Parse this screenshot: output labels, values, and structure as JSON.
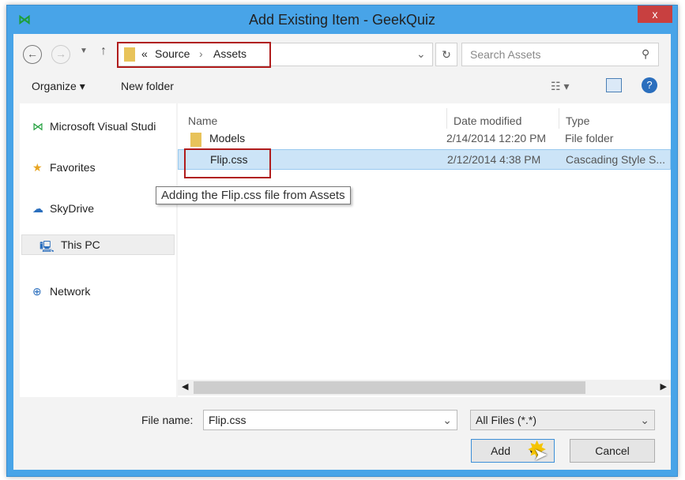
{
  "window": {
    "title": "Add Existing Item - GeekQuiz",
    "close": "x"
  },
  "address": {
    "prefix": "«",
    "path": [
      "Source",
      "Assets"
    ],
    "sep": "›"
  },
  "search": {
    "placeholder": "Search Assets"
  },
  "toolbar": {
    "organize": "Organize ▾",
    "new_folder": "New folder"
  },
  "sidebar": {
    "items": [
      {
        "label": "Microsoft Visual Studi",
        "icon": "visual-studio-icon"
      },
      {
        "label": "Favorites",
        "icon": "star-icon"
      },
      {
        "label": "SkyDrive",
        "icon": "cloud-icon"
      },
      {
        "label": "This PC",
        "icon": "computer-icon",
        "selected": true
      },
      {
        "label": "Network",
        "icon": "network-icon"
      }
    ]
  },
  "columns": {
    "name": "Name",
    "date": "Date modified",
    "type": "Type"
  },
  "files": [
    {
      "name": "Models",
      "date": "2/14/2014 12:20 PM",
      "type": "File folder"
    },
    {
      "name": "Flip.css",
      "date": "2/12/2014 4:38 PM",
      "type": "Cascading Style S...",
      "selected": true
    }
  ],
  "tooltip": "Adding the Flip.css file from Assets",
  "bottom": {
    "file_name_label": "File name:",
    "file_name": "Flip.css",
    "filter": "All Files (*.*)",
    "add": "Add",
    "cancel": "Cancel"
  },
  "colors": {
    "frame": "#48a4e8",
    "close": "#c84040",
    "highlight": "#b01c1c",
    "selection": "#cce4f7"
  }
}
